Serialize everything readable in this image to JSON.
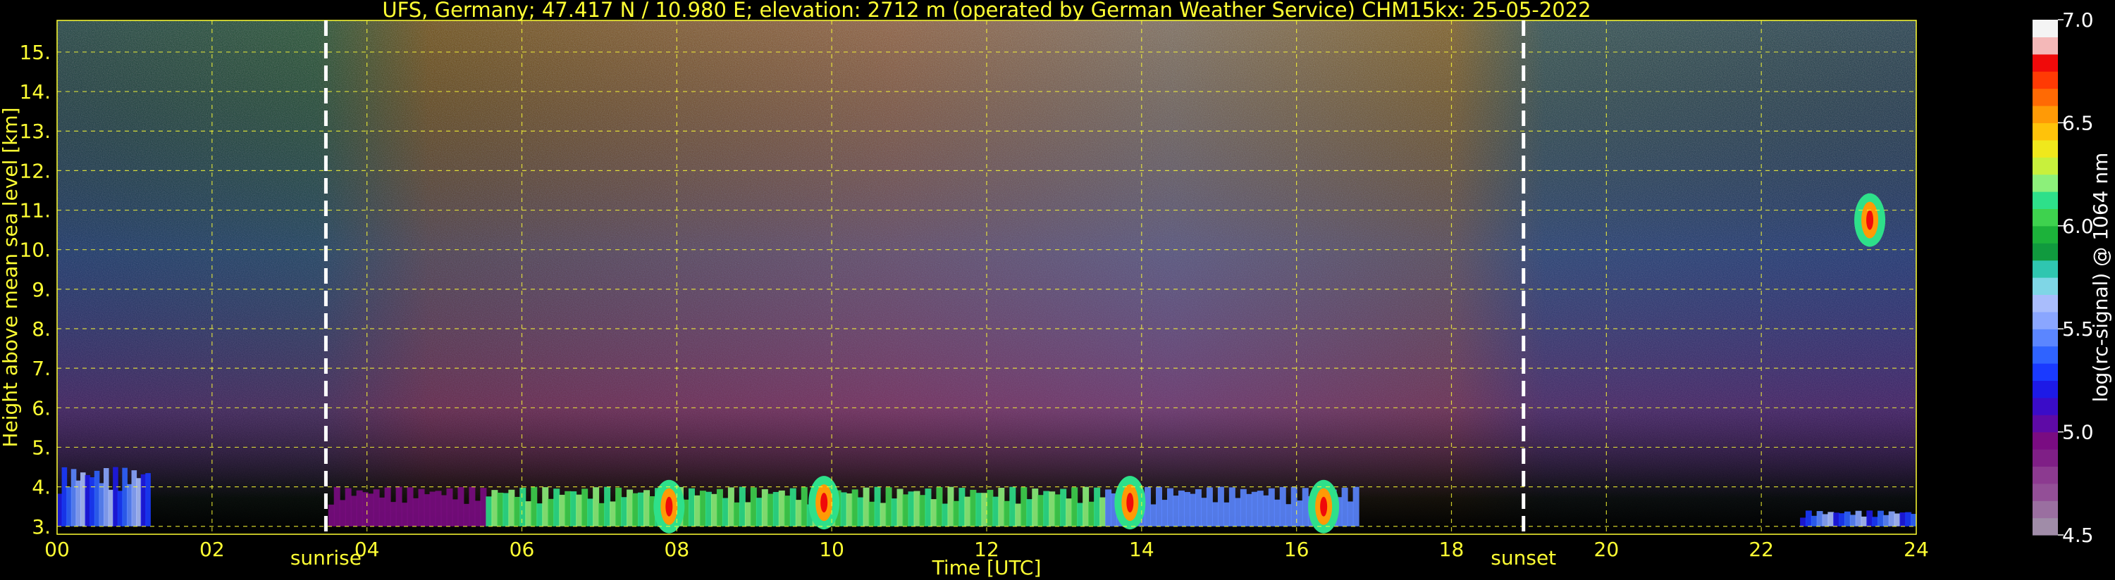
{
  "chart_data": {
    "type": "heatmap",
    "title": "UFS, Germany; 47.417 N / 10.980 E; elevation: 2712 m  (operated by German Weather Service)    CHM15kx: 25-05-2022",
    "xlabel": "Time [UTC]",
    "ylabel": "Height above mean sea level [km]",
    "xlim": [
      0,
      24
    ],
    "ylim": [
      2.8,
      15.8
    ],
    "x_ticks": [
      "00",
      "02",
      "04",
      "06",
      "08",
      "10",
      "12",
      "14",
      "16",
      "18",
      "20",
      "22",
      "24"
    ],
    "y_ticks": [
      "3.",
      "4.",
      "5.",
      "6.",
      "7.",
      "8.",
      "9.",
      "10.",
      "11.",
      "12.",
      "13.",
      "14.",
      "15."
    ],
    "grid": true,
    "colorbar": {
      "label": "log(rc-signal) @ 1064 nm",
      "range": [
        4.5,
        7.0
      ],
      "ticks": [
        "4.5",
        "5.0",
        "5.5",
        "6.0",
        "6.5",
        "7.0"
      ],
      "colors": [
        "#a08ca8",
        "#9a6fa0",
        "#934f97",
        "#8c3a90",
        "#7f1f86",
        "#7a0c82",
        "#5e0aa6",
        "#3a0cc8",
        "#1d1ae6",
        "#1a3aff",
        "#2f63ff",
        "#5b86ff",
        "#8aa6ff",
        "#a9bdfc",
        "#7fd6e6",
        "#2fc6b0",
        "#109a3e",
        "#1cb23a",
        "#3ed24e",
        "#2ee08a",
        "#8cf07a",
        "#c8f03c",
        "#f0e81c",
        "#ffc20a",
        "#ff9a06",
        "#ff6a04",
        "#ff3a04",
        "#f00a0a",
        "#f4b8b8",
        "#f4f4f4"
      ]
    },
    "markers": [
      {
        "label": "sunrise",
        "x": 3.47
      },
      {
        "label": "sunset",
        "x": 18.93
      }
    ],
    "features": [
      {
        "desc": "aerosol layer",
        "t0": 3.5,
        "t1": 16.8,
        "h0": 3.0,
        "h1": 4.0
      },
      {
        "desc": "cloud",
        "t": 7.9,
        "h": 3.5
      },
      {
        "desc": "cloud",
        "t": 9.9,
        "h": 3.6
      },
      {
        "desc": "cloud",
        "t": 13.85,
        "h": 3.6
      },
      {
        "desc": "cloud",
        "t": 16.35,
        "h": 3.5
      },
      {
        "desc": "cloud",
        "t": 23.4,
        "h": 10.75
      },
      {
        "desc": "low layer",
        "t0": 0.0,
        "t1": 1.2,
        "h0": 3.0,
        "h1": 4.5
      },
      {
        "desc": "low layer",
        "t0": 22.5,
        "t1": 24.0,
        "h0": 3.0,
        "h1": 3.4
      }
    ]
  }
}
